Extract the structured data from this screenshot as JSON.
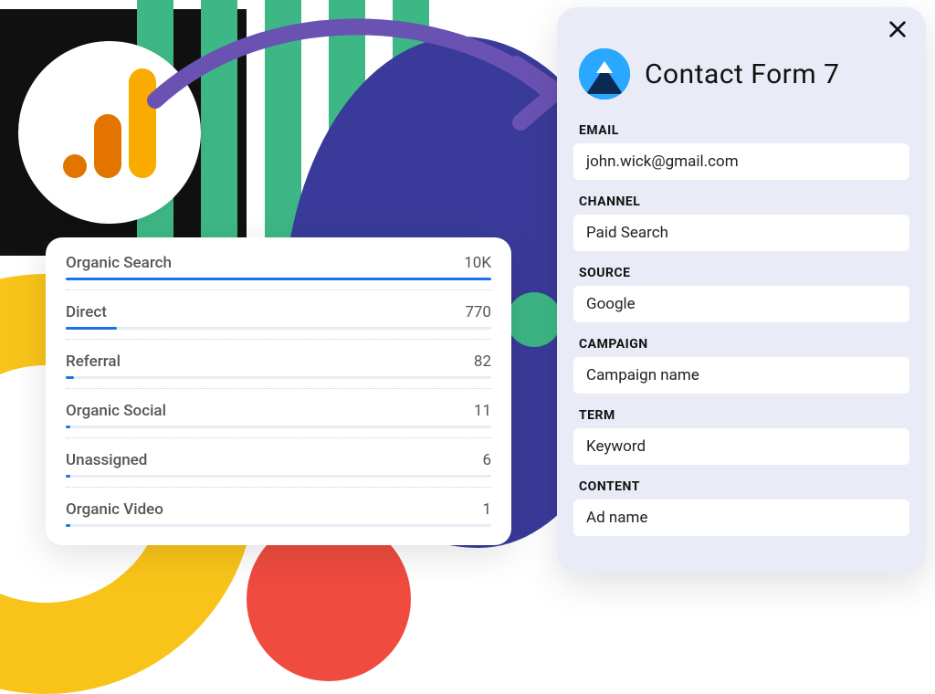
{
  "analytics": {
    "rows": [
      {
        "label": "Organic Search",
        "value": "10K",
        "pct": 100
      },
      {
        "label": "Direct",
        "value": "770",
        "pct": 12
      },
      {
        "label": "Referral",
        "value": "82",
        "pct": 2
      },
      {
        "label": "Organic Social",
        "value": "11",
        "pct": 1
      },
      {
        "label": "Unassigned",
        "value": "6",
        "pct": 1
      },
      {
        "label": "Organic Video",
        "value": "1",
        "pct": 1
      }
    ]
  },
  "form": {
    "title": "Contact Form 7",
    "fields": [
      {
        "label": "EMAIL",
        "value": "john.wick@gmail.com"
      },
      {
        "label": "CHANNEL",
        "value": "Paid Search"
      },
      {
        "label": "SOURCE",
        "value": "Google"
      },
      {
        "label": "CAMPAIGN",
        "value": "Campaign name"
      },
      {
        "label": "TERM",
        "value": "Keyword"
      },
      {
        "label": "CONTENT",
        "value": "Ad name"
      }
    ]
  },
  "chart_data": {
    "type": "bar",
    "title": "",
    "categories": [
      "Organic Search",
      "Direct",
      "Referral",
      "Organic Social",
      "Unassigned",
      "Organic Video"
    ],
    "values": [
      10000,
      770,
      82,
      11,
      6,
      1
    ],
    "value_labels": [
      "10K",
      "770",
      "82",
      "11",
      "6",
      "1"
    ]
  }
}
